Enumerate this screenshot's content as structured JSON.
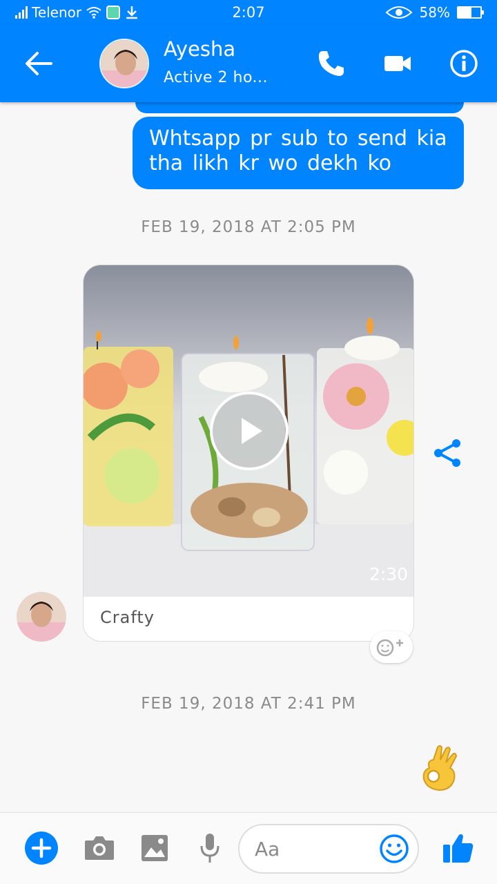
{
  "status_bar": {
    "carrier": "Telenor",
    "time": "2:07",
    "battery": "58%",
    "battery_level": 0.58,
    "icons": [
      "signal-icon",
      "wifi-icon",
      "app-notification-icon",
      "download-icon",
      "eye-icon",
      "battery-icon"
    ]
  },
  "header": {
    "contact_name": "Ayesha",
    "status": "Active 2 ho...",
    "icons": [
      "back-arrow-icon",
      "phone-icon",
      "video-camera-icon",
      "info-icon"
    ]
  },
  "messages": [
    {
      "type": "outgoing_text",
      "text": "Whtsapp pr sub to send kia tha likh kr wo dekh ko"
    },
    {
      "type": "timestamp",
      "text": "FEB 19, 2018 AT 2:05 PM"
    },
    {
      "type": "incoming_video",
      "duration": "2:30",
      "caption": "Crafty"
    },
    {
      "type": "timestamp",
      "text": "FEB 19, 2018 AT 2:41 PM"
    },
    {
      "type": "outgoing_emoji",
      "emoji": "ok-hand-icon"
    }
  ],
  "composer": {
    "placeholder": "Aa",
    "icons": [
      "plus-icon",
      "camera-icon",
      "image-icon",
      "microphone-icon",
      "emoji-icon",
      "thumbs-up-icon"
    ]
  },
  "colors": {
    "accent": "#0084ff",
    "background": "#f7f7f7",
    "timestamp_text": "#8a8a8a"
  }
}
